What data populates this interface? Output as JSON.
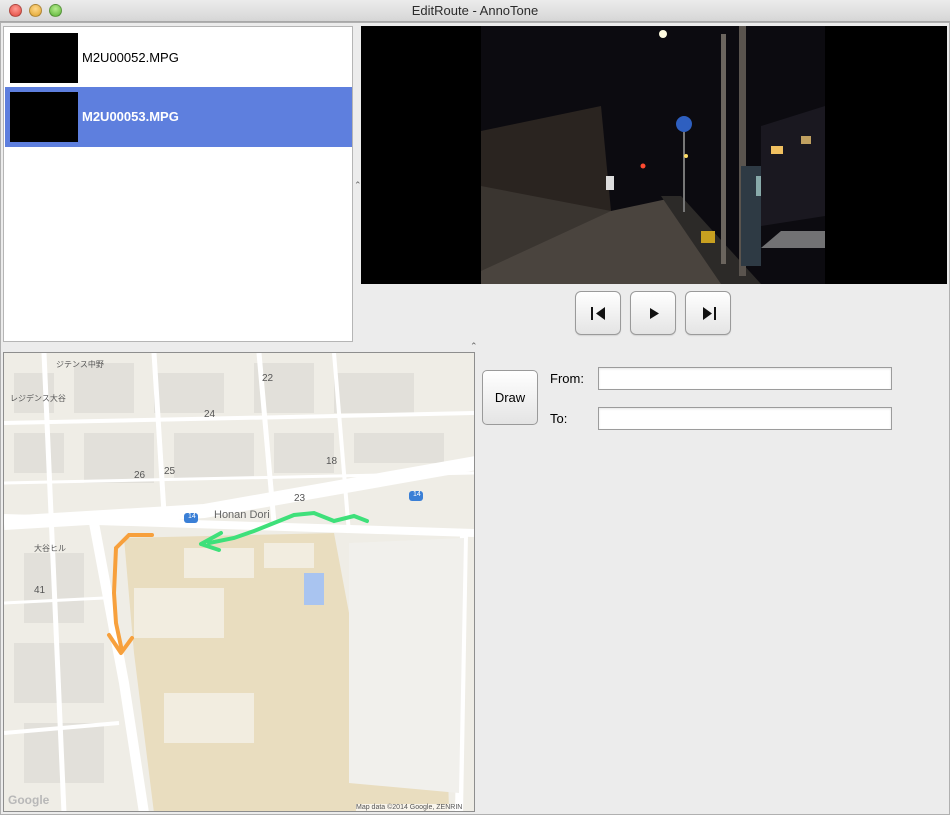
{
  "window": {
    "title": "EditRoute - AnnoTone"
  },
  "files": [
    {
      "name": "M2U00052.MPG",
      "selected": false
    },
    {
      "name": "M2U00053.MPG",
      "selected": true
    }
  ],
  "colors": {
    "selection": "#5e7fde",
    "route_green": "#3ee07a",
    "route_orange": "#f7a03c"
  },
  "playback": {
    "prev_icon": "skip-back-icon",
    "play_icon": "play-icon",
    "next_icon": "skip-forward-icon"
  },
  "map": {
    "road_label": "Honan Dori",
    "route_number": "14",
    "labels": [
      "ジテンス中野",
      "レジデンス大谷",
      "22",
      "24",
      "26",
      "25",
      "23",
      "18",
      "中野",
      "41",
      "大谷ヒル"
    ],
    "google_logo": "Google",
    "attribution": "Map data ©2014 Google, ZENRIN"
  },
  "form": {
    "draw_label": "Draw",
    "from_label": "From:",
    "to_label": "To:",
    "from_value": "",
    "to_value": ""
  }
}
